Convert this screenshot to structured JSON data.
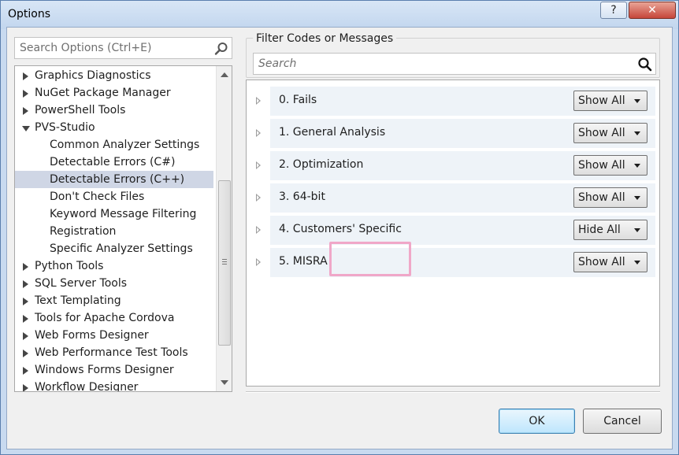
{
  "window": {
    "title": "Options",
    "help_glyph": "?",
    "close_glyph": "✕"
  },
  "tree_search": {
    "placeholder": "Search Options (Ctrl+E)"
  },
  "tree": {
    "items": [
      {
        "label": "Graphics Diagnostics",
        "level": 0,
        "expander": "collapsed",
        "selected": false
      },
      {
        "label": "NuGet Package Manager",
        "level": 0,
        "expander": "collapsed",
        "selected": false
      },
      {
        "label": "PowerShell Tools",
        "level": 0,
        "expander": "collapsed",
        "selected": false
      },
      {
        "label": "PVS-Studio",
        "level": 0,
        "expander": "expanded",
        "selected": false
      },
      {
        "label": "Common Analyzer Settings",
        "level": 1,
        "expander": "none",
        "selected": false
      },
      {
        "label": "Detectable Errors (C#)",
        "level": 1,
        "expander": "none",
        "selected": false
      },
      {
        "label": "Detectable Errors (C++)",
        "level": 1,
        "expander": "none",
        "selected": true
      },
      {
        "label": "Don't Check Files",
        "level": 1,
        "expander": "none",
        "selected": false
      },
      {
        "label": "Keyword Message Filtering",
        "level": 1,
        "expander": "none",
        "selected": false
      },
      {
        "label": "Registration",
        "level": 1,
        "expander": "none",
        "selected": false
      },
      {
        "label": "Specific Analyzer Settings",
        "level": 1,
        "expander": "none",
        "selected": false
      },
      {
        "label": "Python Tools",
        "level": 0,
        "expander": "collapsed",
        "selected": false
      },
      {
        "label": "SQL Server Tools",
        "level": 0,
        "expander": "collapsed",
        "selected": false
      },
      {
        "label": "Text Templating",
        "level": 0,
        "expander": "collapsed",
        "selected": false
      },
      {
        "label": "Tools for Apache Cordova",
        "level": 0,
        "expander": "collapsed",
        "selected": false
      },
      {
        "label": "Web Forms Designer",
        "level": 0,
        "expander": "collapsed",
        "selected": false
      },
      {
        "label": "Web Performance Test Tools",
        "level": 0,
        "expander": "collapsed",
        "selected": false
      },
      {
        "label": "Windows Forms Designer",
        "level": 0,
        "expander": "collapsed",
        "selected": false
      },
      {
        "label": "Workflow Designer",
        "level": 0,
        "expander": "collapsed",
        "selected": false
      }
    ]
  },
  "filter": {
    "label": "Filter Codes or Messages",
    "placeholder": "Search"
  },
  "groups": [
    {
      "label": "0. Fails",
      "value": "Show All"
    },
    {
      "label": "1. General Analysis",
      "value": "Show All"
    },
    {
      "label": "2. Optimization",
      "value": "Show All"
    },
    {
      "label": "3. 64-bit",
      "value": "Show All"
    },
    {
      "label": "4. Customers' Specific",
      "value": "Hide All"
    },
    {
      "label": "5. MISRA",
      "value": "Show All"
    }
  ],
  "highlight_color": "#f0a7c8",
  "selection_color": "#cfd6e5",
  "buttons": {
    "ok": "OK",
    "cancel": "Cancel"
  }
}
